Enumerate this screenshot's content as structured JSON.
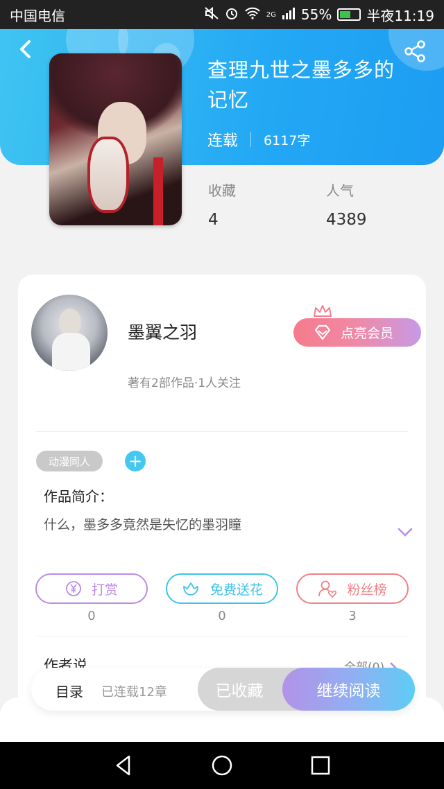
{
  "status_bar": {
    "carrier": "中国电信",
    "network": "2G",
    "battery": "55%",
    "battery_level": 0.55,
    "time": "半夜11:19",
    "icons": [
      "mute-icon",
      "alarm-icon",
      "wifi-icon",
      "signal-icon",
      "battery-icon"
    ]
  },
  "book": {
    "title": "查理九世之墨多多的记忆",
    "status": "连载",
    "word_count": "6117字",
    "stats": [
      {
        "label": "收藏",
        "value": "4"
      },
      {
        "label": "人气",
        "value": "4389"
      }
    ]
  },
  "author": {
    "name": "墨翼之羽",
    "info": "著有2部作品·1人关注",
    "vip_label": "点亮会员"
  },
  "tags": [
    "动漫同人"
  ],
  "tag_add_symbol": "+",
  "intro": {
    "label": "作品简介：",
    "text": "什么，墨多多竟然是失忆的墨羽瞳"
  },
  "actions": [
    {
      "label": "打赏",
      "count": "0",
      "icon": "yen-coin-icon",
      "color": "#b98be6"
    },
    {
      "label": "免费送花",
      "count": "0",
      "icon": "flower-icon",
      "color": "#3ec3ea"
    },
    {
      "label": "粉丝榜",
      "count": "3",
      "icon": "fan-ranking-icon",
      "color": "#f07f86"
    }
  ],
  "author_says": {
    "label": "作者说",
    "all_link": "全部(0)"
  },
  "bottom_bar": {
    "toc_label": "目录",
    "chapter_count": "已连载12章",
    "collected_label": "已收藏",
    "read_label": "继续阅读"
  },
  "colors": {
    "header_gradient_start": "#3fc4f2",
    "header_gradient_end": "#1d9df2",
    "tag_add": "#45c8f0",
    "vip_gradient_start": "#f57b8c",
    "vip_gradient_end": "#c69ae6"
  }
}
